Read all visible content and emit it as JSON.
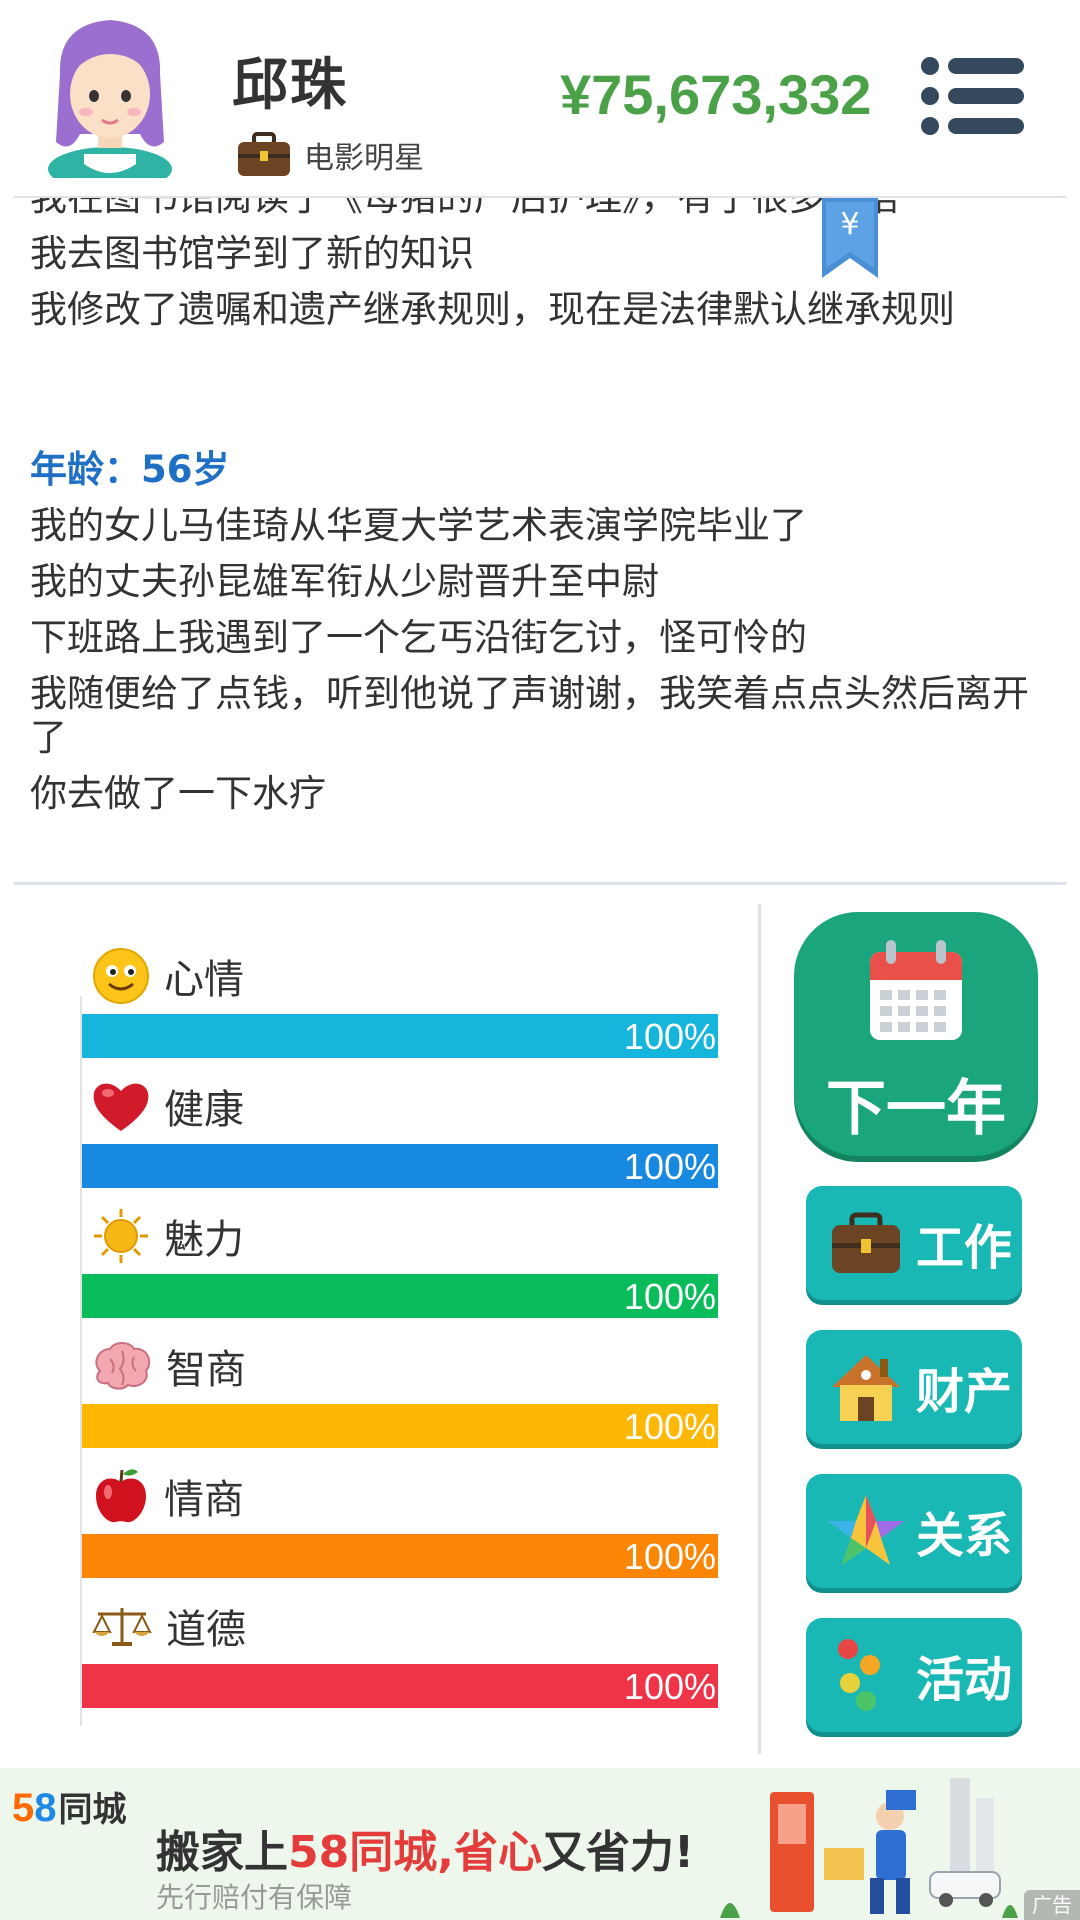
{
  "header": {
    "name": "邱珠",
    "job": "电影明星",
    "money": "¥75,673,332"
  },
  "bookmark": {
    "symbol": "¥"
  },
  "log": {
    "lines_before": [
      "我在图书馆阅读了《母猪的产后护理》，有了很多感悟",
      "我去图书馆学到了新的知识",
      "我修改了遗嘱和遗产继承规则，现在是法律默认继承规则"
    ],
    "age_label": "年龄：56岁",
    "lines_after": [
      "我的女儿马佳琦从华夏大学艺术表演学院毕业了",
      "我的丈夫孙昆雄军衔从少尉晋升至中尉",
      "下班路上我遇到了一个乞丐沿街乞讨，怪可怜的",
      "我随便给了点钱，听到他说了声谢谢，我笑着点点头然后离开了",
      "你去做了一下水疗"
    ]
  },
  "stats": [
    {
      "label": "心情",
      "value": "100%",
      "fraction": 1.0,
      "color": "#16b5db",
      "icon": "smiley-icon"
    },
    {
      "label": "健康",
      "value": "100%",
      "fraction": 1.0,
      "color": "#1889e0",
      "icon": "heart-icon"
    },
    {
      "label": "魅力",
      "value": "100%",
      "fraction": 1.0,
      "color": "#0bbd5a",
      "icon": "sun-icon"
    },
    {
      "label": "智商",
      "value": "100%",
      "fraction": 1.0,
      "color": "#fdb704",
      "icon": "brain-icon"
    },
    {
      "label": "情商",
      "value": "100%",
      "fraction": 1.0,
      "color": "#fb8606",
      "icon": "apple-icon"
    },
    {
      "label": "道德",
      "value": "100%",
      "fraction": 1.0,
      "color": "#ef3448",
      "icon": "scales-icon"
    }
  ],
  "buttons": {
    "next_year": "下一年",
    "work": "工作",
    "property": "财产",
    "relations": "关系",
    "activity": "活动"
  },
  "ad": {
    "brand_58": "58",
    "brand_name": "同城",
    "slogan_part1": "搬家上",
    "slogan_part2": "58同城,省心",
    "slogan_part3": "又省力!",
    "subtext": "先行赔付有保障",
    "tag": "广告"
  },
  "colors": {
    "money": "#4aa148",
    "age": "#1f6fc5",
    "next_year_bg": "#1aa57c",
    "side_button_bg": "#1ab8b4"
  }
}
